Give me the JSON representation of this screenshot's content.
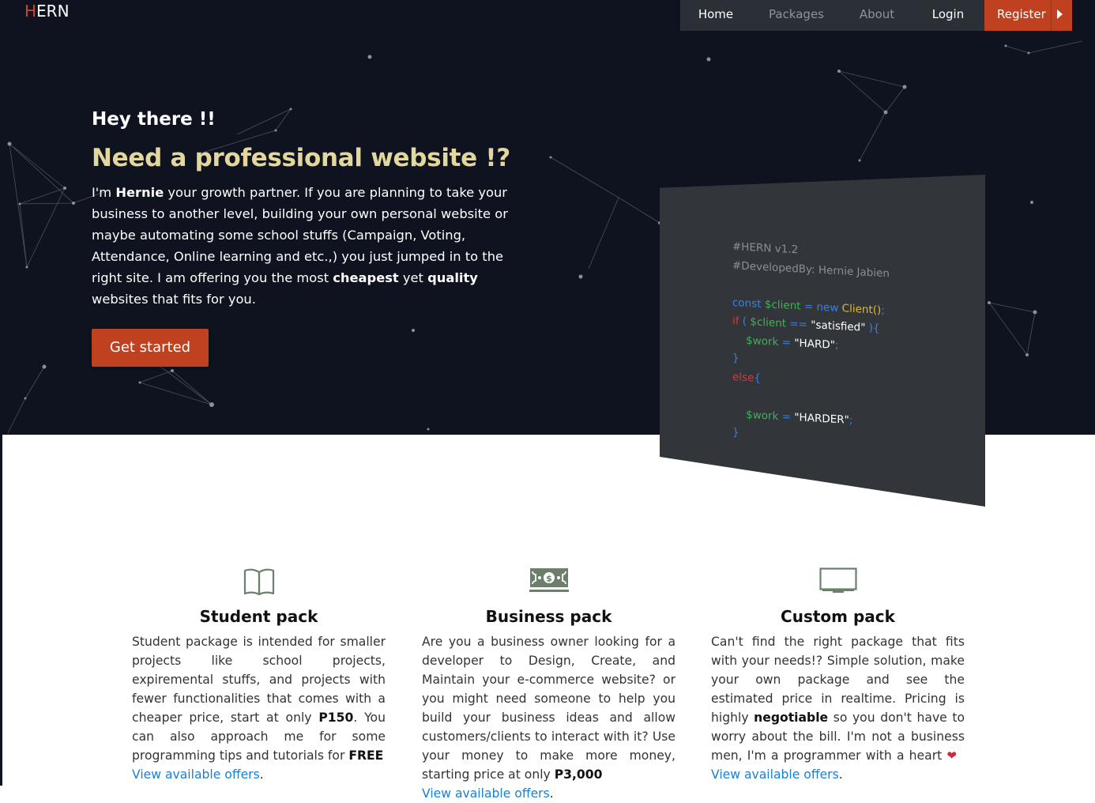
{
  "brand": {
    "first_letter": "H",
    "rest": "ERN"
  },
  "nav": {
    "items": [
      {
        "label": "Home"
      },
      {
        "label": "Packages"
      },
      {
        "label": "About"
      },
      {
        "label": "Login"
      }
    ],
    "register_label": "Register"
  },
  "hero": {
    "greeting": "Hey there !!",
    "headline": "Need a professional website !?",
    "intro": {
      "p1": "I'm ",
      "name": "Hernie",
      "p2": " your growth partner. If you are planning to take your business to another level, building your own personal website or maybe automating some school stuffs (Campaign, Voting, Attendance, Online learning and etc.,) you just jumped in to the right site. I am offering you the most ",
      "w1": "cheapest",
      "p3": " yet ",
      "w2": "quality",
      "p4": " websites that fits for you."
    },
    "cta_label": "Get started"
  },
  "code_card": {
    "comment1": "#HERN v1.2",
    "comment2": "#DevelopedBy: Hernie Jabien",
    "line1": {
      "kw": "const",
      "var": "$client",
      "op": " = ",
      "new": "new",
      "cls": "Client()",
      "end": ";"
    },
    "line2": {
      "kw": "if",
      "open": " ( ",
      "var": "$client",
      "op": " == ",
      "str": "\"satisfied\"",
      "close": " ){"
    },
    "line3": {
      "var": "$work",
      "op": " = ",
      "str": "\"HARD\"",
      "end": ";"
    },
    "line4": "}",
    "line5": {
      "kw": "else",
      "open": "{"
    },
    "line6": {
      "var": "$work",
      "op": " = ",
      "str": "\"HARDER\"",
      "end": ";"
    },
    "line7": "}"
  },
  "packs": [
    {
      "icon": "book-icon",
      "title": "Student pack",
      "text1": "Student package is intended for smaller projects like school projects, expiremental stuffs, and projects with fewer functionalities that comes with a cheaper price, start at only ",
      "bold1": "P150",
      "text2": ". You can also approach me for some programming tips and tutorials for ",
      "bold2": "FREE",
      "link": "View available offers",
      "end": "."
    },
    {
      "icon": "money-bill-icon",
      "title": "Business pack",
      "text1": "Are you a business owner looking for a developer to Design, Create, and Maintain your e-commerce website? or you might need someone to help you build your business ideas and allow customers/clients to interact with it? Use your money to make more money, starting price at only ",
      "bold1": "P3,000",
      "link": "View available offers",
      "end": "."
    },
    {
      "icon": "monitor-icon",
      "title": "Custom pack",
      "text1": "Can't find the right package that fits with your needs!? Simple solution, make your own package and see the estimated price in realtime. Pricing is highly ",
      "bold1": "negotiable",
      "text2": " so you don't have to worry about the bill. I'm not a business men, I'm a programmer with a heart",
      "link": "View available offers",
      "end": "."
    }
  ],
  "colors": {
    "hero_bg": "#0f1320",
    "accent": "#c0411f",
    "headline": "#e3d79d",
    "link": "#1a7fd4",
    "icon": "#6b7f6b"
  }
}
